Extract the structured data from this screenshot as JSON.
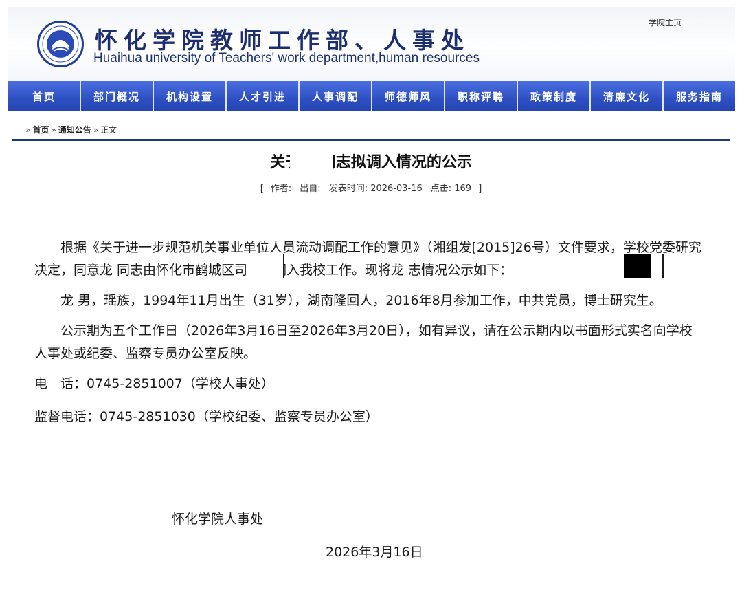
{
  "header": {
    "title_cn": "怀化学院教师工作部、人事处",
    "title_en": "Huaihua university of Teachers' work department,human resources",
    "home_link": "学院主页",
    "brand_color": "#2f54c8",
    "logo_icon": "university-seal"
  },
  "nav": {
    "items": [
      {
        "label": "首页"
      },
      {
        "label": "部门概况"
      },
      {
        "label": "机构设置"
      },
      {
        "label": "人才引进"
      },
      {
        "label": "人事调配"
      },
      {
        "label": "师德师风"
      },
      {
        "label": "职称评聘"
      },
      {
        "label": "政策制度"
      },
      {
        "label": "清廉文化"
      },
      {
        "label": "服务指南"
      }
    ]
  },
  "breadcrumb": {
    "prefix": "»",
    "items": [
      "首页",
      "通知公告",
      "正文"
    ],
    "separator": "»"
  },
  "article": {
    "title": "关于龙 同志拟调入情况的公示",
    "meta": {
      "author_label": "作者:",
      "source_label": "出自:",
      "publish_label": "发表时间: 2026-03-16",
      "clicks_label": "点击: 169"
    },
    "paragraphs": [
      "根据《关于进一步规范机关事业单位人员流动调配工作的意见》（湘组发[2015]26号）文件要求，学校党委研究决定，同意龙 同志由怀化市鹤城区司法局调入我校工作。现将龙 志情况公示如下：",
      "龙 男，瑶族，1994年11月出生（31岁），湖南隆回人，2016年8月参加工作，中共党员，博士研究生。",
      "公示期为五个工作日（2026年3月16日至2026年3月20日），如有异议，请在公示期内以书面形式实名向学校人事处或纪委、监察专员办公室反映。"
    ],
    "contacts": [
      "电　话：0745-2851007（学校人事处）",
      "监督电话：0745-2851030（学校纪委、监察专员办公室）"
    ],
    "signature": "怀化学院人事处",
    "date": "2026年3月16日"
  }
}
